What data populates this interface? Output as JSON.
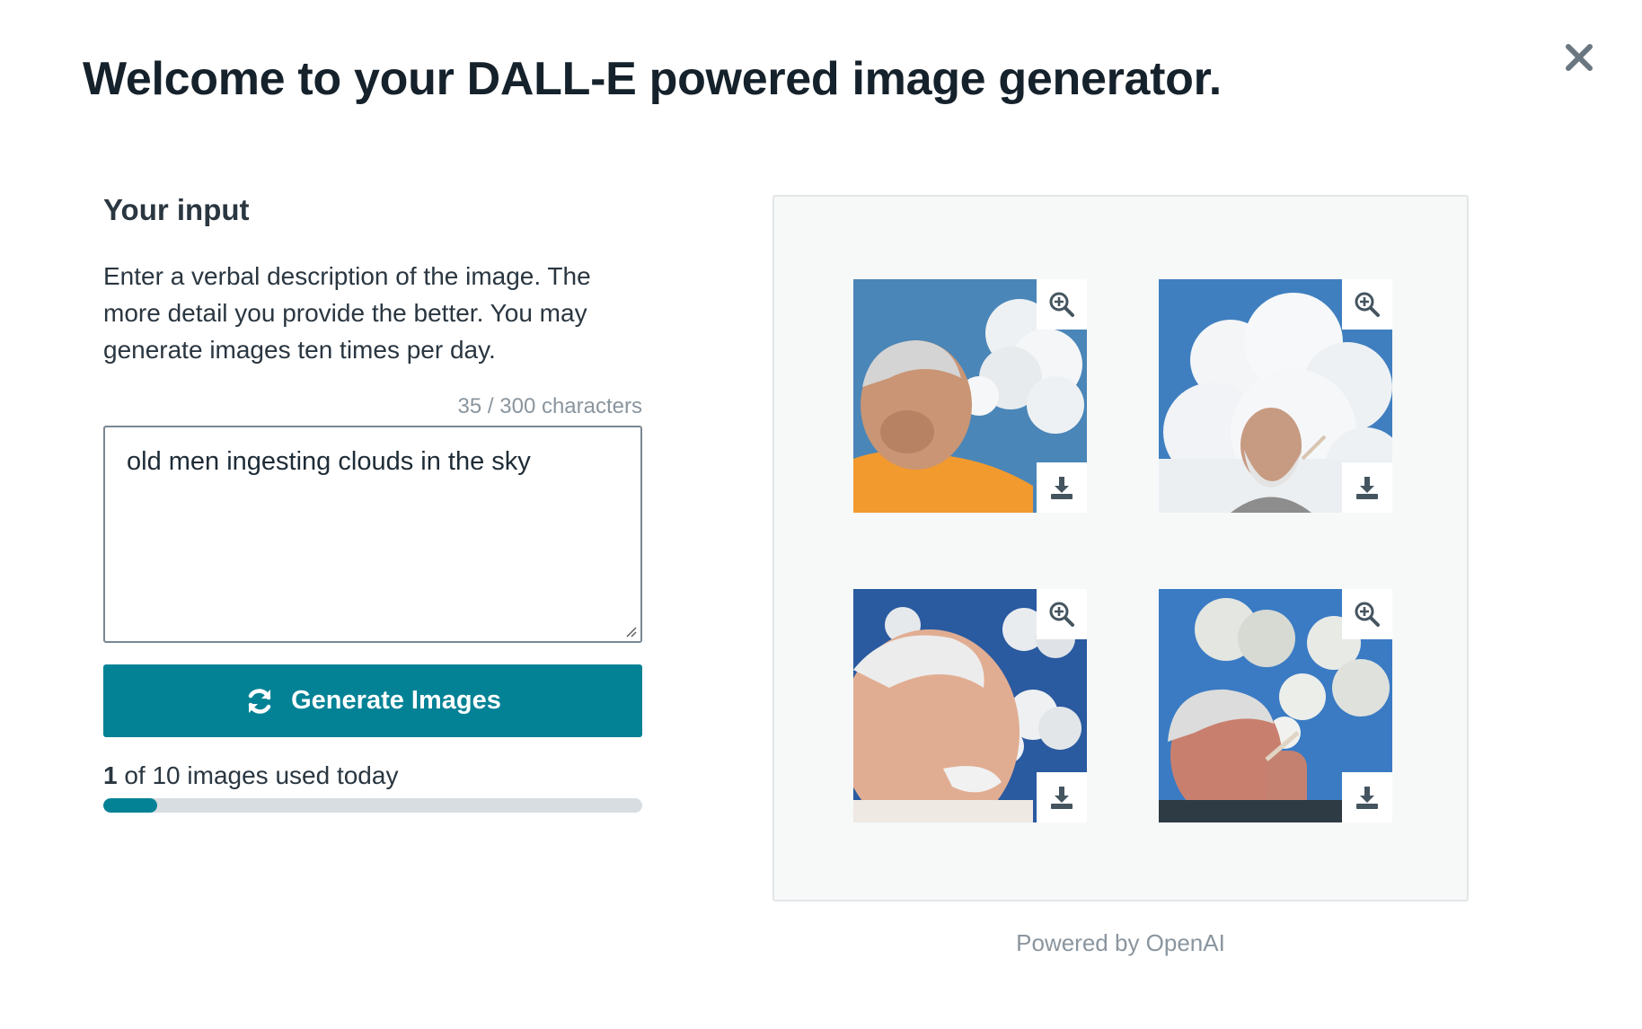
{
  "modal": {
    "title": "Welcome to your DALL-E powered image generator.",
    "close_icon": "close-icon"
  },
  "input_panel": {
    "heading": "Your input",
    "instructions": "Enter a verbal description of the image. The more detail you provide the better. You may generate images ten times per day.",
    "char_count": "35 / 300 characters",
    "prompt_value": "old men ingesting clouds in the sky",
    "generate_label": "Generate Images",
    "generate_icon": "refresh-icon",
    "usage_count": "1",
    "usage_suffix": " of 10 images used today",
    "usage_fraction": 0.1
  },
  "gallery": {
    "images": [
      {
        "zoom_icon": "zoom-in-icon",
        "download_icon": "download-icon"
      },
      {
        "zoom_icon": "zoom-in-icon",
        "download_icon": "download-icon"
      },
      {
        "zoom_icon": "zoom-in-icon",
        "download_icon": "download-icon"
      },
      {
        "zoom_icon": "zoom-in-icon",
        "download_icon": "download-icon"
      }
    ]
  },
  "footer": {
    "powered_by": "Powered by OpenAI"
  },
  "colors": {
    "accent": "#038296",
    "title": "#15212b",
    "muted": "#8a959e",
    "track": "#d8dde1"
  }
}
